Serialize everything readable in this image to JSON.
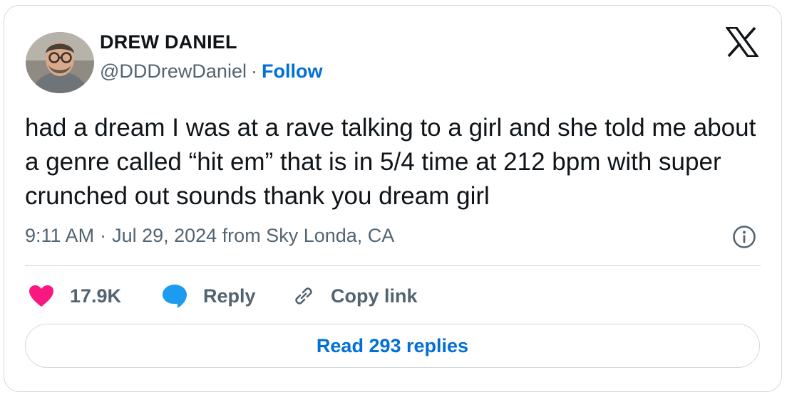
{
  "author": {
    "name": "DREW DANIEL",
    "handle": "@DDDrewDaniel",
    "separator": "·",
    "follow_label": "Follow"
  },
  "tweet": {
    "text": "had a dream I was at a rave talking to a girl and she told me about a genre called “hit em” that is in 5/4 time at 212 bpm with super crunched out sounds thank you dream girl",
    "time": "9:11 AM",
    "separator": "·",
    "date_location": "Jul 29, 2024 from Sky Londa, CA"
  },
  "actions": {
    "like_count": "17.9K",
    "reply_label": "Reply",
    "copy_link_label": "Copy link"
  },
  "read_replies_label": "Read 293 replies",
  "icons": {
    "platform": "x-logo-icon",
    "info": "info-icon",
    "like": "heart-icon",
    "reply": "speech-bubble-icon",
    "copy": "link-icon"
  },
  "colors": {
    "like": "#f91880",
    "reply": "#1d9bf0",
    "link": "#006fd6",
    "secondary_text": "#536471",
    "border": "#cfd9de"
  }
}
